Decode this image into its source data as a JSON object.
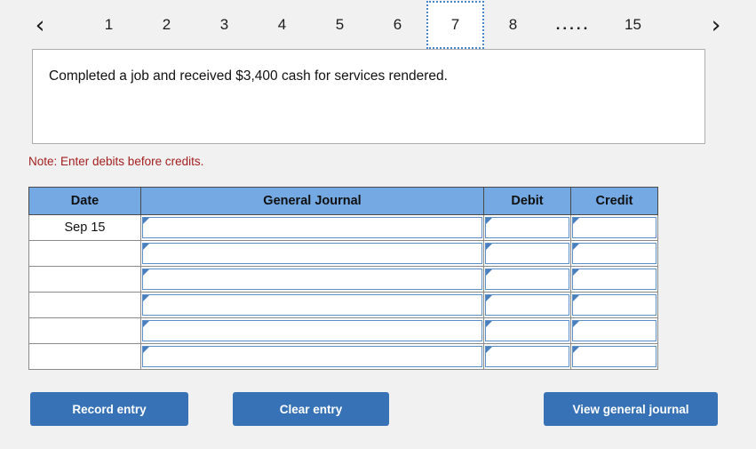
{
  "pager": {
    "prev_icon": "chevron-left-icon",
    "next_icon": "chevron-right-icon",
    "prev_glyph": "‹",
    "next_glyph": "›",
    "pages": [
      "1",
      "2",
      "3",
      "4",
      "5",
      "6",
      "7",
      "8",
      ".....",
      "15"
    ],
    "active_page": "7"
  },
  "prompt": {
    "text": "Completed a job and received $3,400 cash for services rendered."
  },
  "note": {
    "text": "Note: Enter debits before credits."
  },
  "journal": {
    "headers": [
      "Date",
      "General Journal",
      "Debit",
      "Credit"
    ],
    "rows": [
      {
        "date": "Sep 15",
        "general_journal": "",
        "debit": "",
        "credit": ""
      },
      {
        "date": "",
        "general_journal": "",
        "debit": "",
        "credit": ""
      },
      {
        "date": "",
        "general_journal": "",
        "debit": "",
        "credit": ""
      },
      {
        "date": "",
        "general_journal": "",
        "debit": "",
        "credit": ""
      },
      {
        "date": "",
        "general_journal": "",
        "debit": "",
        "credit": ""
      },
      {
        "date": "",
        "general_journal": "",
        "debit": "",
        "credit": ""
      }
    ]
  },
  "buttons": {
    "record": "Record entry",
    "clear": "Clear entry",
    "view": "View general journal"
  },
  "colors": {
    "header_blue": "#74a9e3",
    "button_blue": "#3672b5",
    "note_red": "#a32020",
    "page_bg": "#f1f1f1",
    "active_tab_border": "#4a86c8"
  }
}
